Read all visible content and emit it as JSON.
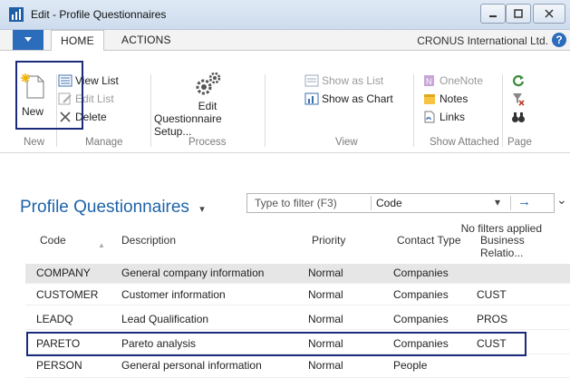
{
  "window": {
    "title": "Edit - Profile Questionnaires"
  },
  "ribbon_tabs": {
    "home": "HOME",
    "actions": "ACTIONS"
  },
  "company": "CRONUS International Ltd.",
  "help_icon": "?",
  "ribbon": {
    "new": "New",
    "view_list": "View List",
    "edit_list": "Edit List",
    "delete": "Delete",
    "edit_setup_line1": "Edit",
    "edit_setup_line2": "Questionnaire Setup...",
    "show_as_list": "Show as List",
    "show_as_chart": "Show as Chart",
    "onenote": "OneNote",
    "notes": "Notes",
    "links": "Links",
    "groups": {
      "new": "New",
      "manage": "Manage",
      "process": "Process",
      "view": "View",
      "show_attached": "Show Attached",
      "page": "Page"
    }
  },
  "page": {
    "title": "Profile Questionnaires",
    "title_chevron": "▾",
    "filter_placeholder": "Type to filter (F3)",
    "filter_field": "Code",
    "filter_dropdown_glyph": "▾",
    "filter_go_glyph": "→",
    "collapse_glyph": "⌄",
    "no_filters": "No filters applied"
  },
  "grid": {
    "sort_glyph": "▲",
    "headers": {
      "code": "Code",
      "description": "Description",
      "priority": "Priority",
      "contact_type": "Contact Type",
      "business_line1": "Business",
      "business_line2": "Relatio..."
    },
    "rows": [
      {
        "code": "COMPANY",
        "description": "General company information",
        "priority": "Normal",
        "contact_type": "Companies",
        "business": ""
      },
      {
        "code": "CUSTOMER",
        "description": "Customer information",
        "priority": "Normal",
        "contact_type": "Companies",
        "business": "CUST"
      },
      {
        "code": "LEADQ",
        "description": "Lead Qualification",
        "priority": "Normal",
        "contact_type": "Companies",
        "business": "PROS"
      },
      {
        "code": "PARETO",
        "description": "Pareto analysis",
        "priority": "Normal",
        "contact_type": "Companies",
        "business": "CUST"
      },
      {
        "code": "PERSON",
        "description": "General personal information",
        "priority": "Normal",
        "contact_type": "People",
        "business": ""
      }
    ]
  },
  "colors": {
    "accent_blue": "#2b6cbb",
    "title_blue": "#1e63a8",
    "highlight_border": "#1b2a7a"
  }
}
